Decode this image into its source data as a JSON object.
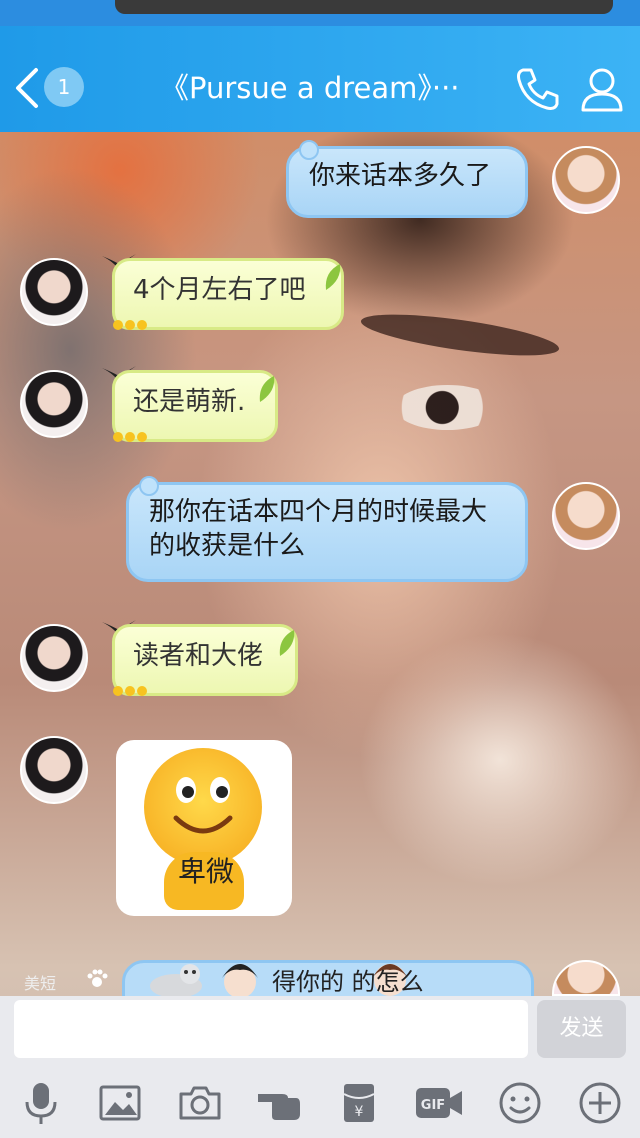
{
  "header": {
    "back_badge": "1",
    "title": "《Pursue a dream》···"
  },
  "messages": [
    {
      "side": "right",
      "text": "你来话本多久了"
    },
    {
      "side": "left",
      "text": "4个月左右了吧"
    },
    {
      "side": "left",
      "text": "还是萌新."
    },
    {
      "side": "right",
      "text": "那你在话本四个月的时候最大的收获是什么"
    },
    {
      "side": "left",
      "text": "读者和大佬"
    },
    {
      "side": "left",
      "sticker": "卑微"
    },
    {
      "side": "right",
      "text": "得你的 的怎么"
    }
  ],
  "decor": {
    "meiduan_label": "美短"
  },
  "input": {
    "send_label": "发送",
    "tools": [
      "mic-icon",
      "image-icon",
      "camera-icon",
      "hand-icon",
      "red-packet-icon",
      "gif-icon",
      "emoji-icon",
      "plus-icon"
    ],
    "gif_label": "GIF"
  },
  "colors": {
    "header": "#1f9ae8",
    "bubble_blue": "#b7dcf8",
    "bubble_yellow": "#f2fac0",
    "input_bg": "#e9eaee"
  }
}
